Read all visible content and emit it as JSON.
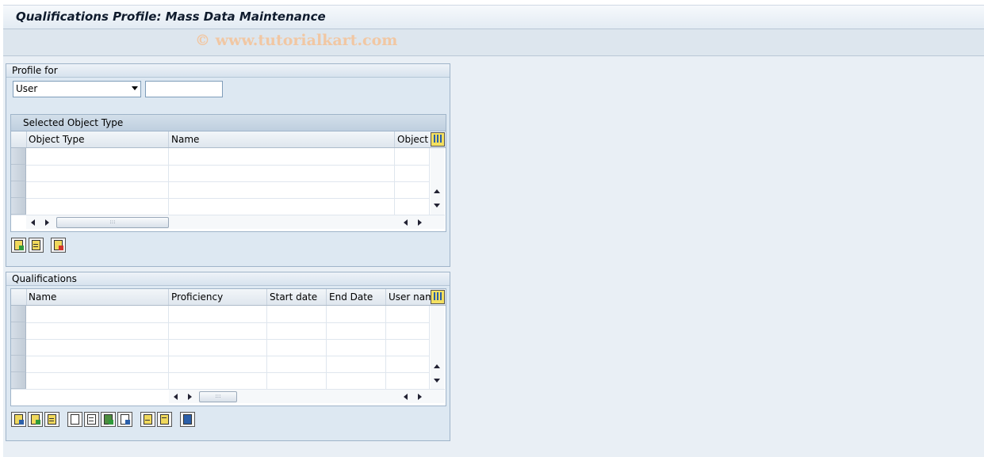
{
  "window": {
    "title": "Qualifications Profile: Mass Data Maintenance"
  },
  "watermark": "© www.tutorialkart.com",
  "profile_for": {
    "group_title": "Profile for",
    "object_type_select": "User",
    "object_id_value": "",
    "table": {
      "caption": "Selected Object Type",
      "columns": [
        "Object Type",
        "Name",
        "Object"
      ],
      "rows": [
        [
          "",
          "",
          ""
        ],
        [
          "",
          "",
          ""
        ],
        [
          "",
          "",
          ""
        ],
        [
          "",
          "",
          ""
        ]
      ]
    }
  },
  "qualifications": {
    "group_title": "Qualifications",
    "table": {
      "columns": [
        "Name",
        "Proficiency",
        "Start date",
        "End Date",
        "User nam"
      ],
      "rows": [
        [
          "",
          "",
          "",
          "",
          ""
        ],
        [
          "",
          "",
          "",
          "",
          ""
        ],
        [
          "",
          "",
          "",
          "",
          ""
        ],
        [
          "",
          "",
          "",
          "",
          ""
        ],
        [
          "",
          "",
          "",
          "",
          ""
        ]
      ]
    }
  },
  "icons": {
    "column_config": "column-settings-icon",
    "profile_buttons": [
      "select-all-icon",
      "deselect-all-icon",
      "delete-row-icon"
    ],
    "qualification_buttons": [
      "details-icon",
      "select-all-icon",
      "deselect-all-icon",
      "create-icon",
      "delete-icon",
      "copy-icon",
      "undo-icon",
      "print-icon",
      "filter-icon",
      "refresh-icon"
    ]
  },
  "colors": {
    "background": "#e9eff5",
    "group_background": "#dde8f2",
    "border": "#9fb4c9",
    "watermark": "#f1c7a3"
  }
}
